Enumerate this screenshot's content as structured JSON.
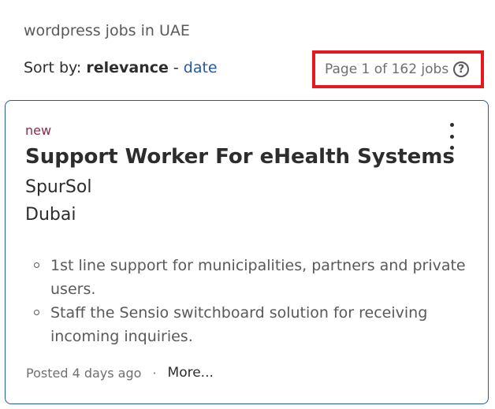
{
  "search": {
    "title": "wordpress jobs in UAE"
  },
  "sort": {
    "prefix": "Sort by:",
    "current": "relevance",
    "separator": "-",
    "alternative": "date"
  },
  "pagination": {
    "label": "Page 1 of 162 jobs",
    "help_glyph": "?"
  },
  "job": {
    "badge": "new",
    "title": "Support Worker For eHealth Systems",
    "company": "SpurSol",
    "location": "Dubai",
    "snippets": [
      "1st line support for municipalities, partners and private users.",
      "Staff the Sensio switchboard solution for receiving incoming inquiries."
    ],
    "posted": "Posted 4 days ago",
    "footer_dot": "·",
    "more_label": "More..."
  },
  "colors": {
    "link": "#2557a7",
    "highlight_border": "#e8171f",
    "new_badge": "#8b2a4d",
    "card_border": "#2557a7"
  },
  "icons": {
    "help": "help-circle-icon",
    "menu": "more-vertical-icon"
  }
}
